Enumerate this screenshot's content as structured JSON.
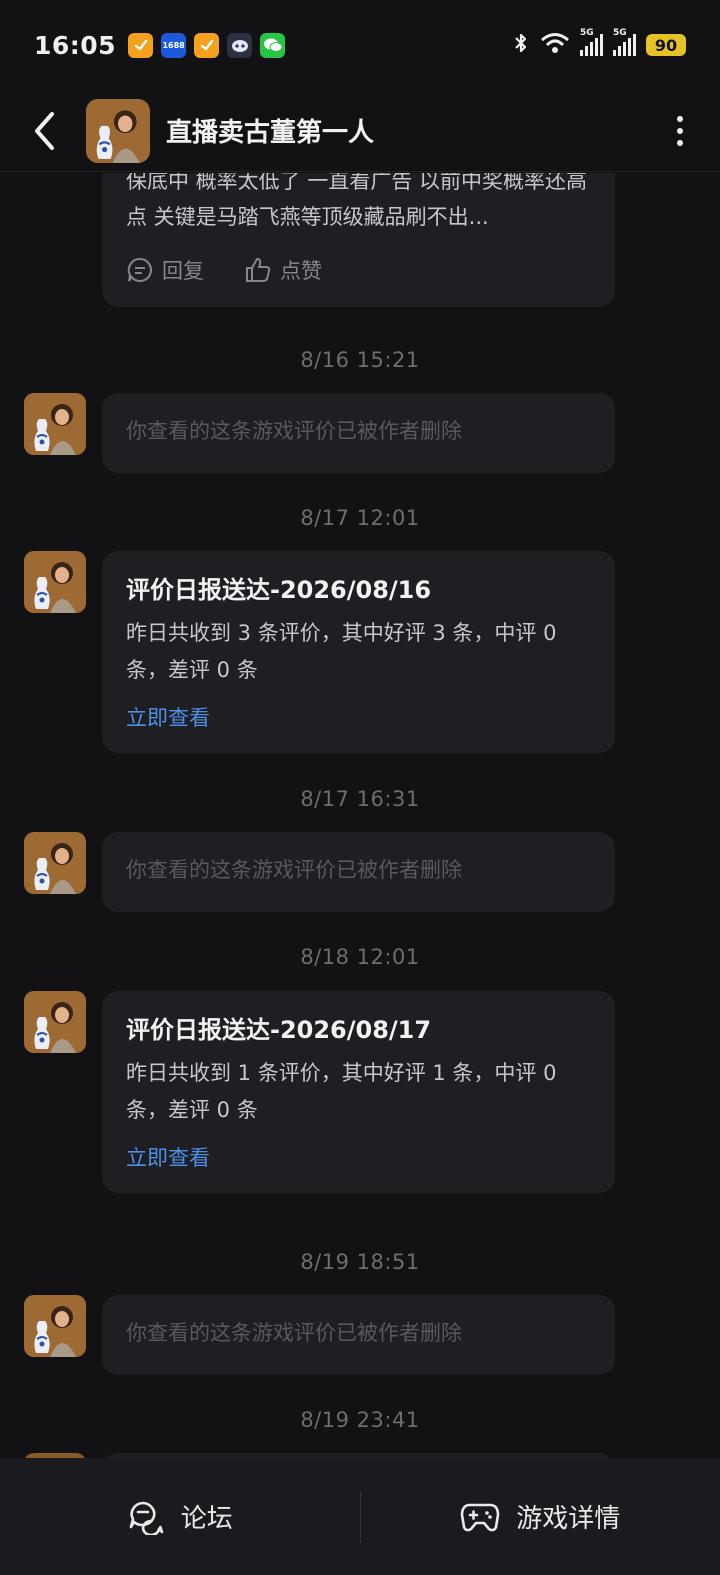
{
  "status_bar": {
    "time": "16:05",
    "app_icons": [
      "taobao-icon",
      "1688-icon",
      "taobao-icon",
      "robot-icon",
      "wechat-icon"
    ],
    "app_1688_label": "1688",
    "signal_1": "5G",
    "signal_2": "5G",
    "battery": "90"
  },
  "header": {
    "title": "直播卖古董第一人"
  },
  "chat": {
    "truncated_message": {
      "text": "保底中 概率太低了 一直看广告 以前中奖概率还高点 关键是马踏飞燕等顶级藏品刷不出...",
      "reply_label": "回复",
      "like_label": "点赞"
    },
    "messages": [
      {
        "timestamp": "8/16  15:21",
        "type": "deleted",
        "text": "你查看的这条游戏评价已被作者删除"
      },
      {
        "timestamp": "8/17  12:01",
        "type": "report",
        "title": "评价日报送达-2026/08/16",
        "body": "昨日共收到 3 条评价，其中好评 3 条，中评 0 条，差评 0 条",
        "link": "立即查看"
      },
      {
        "timestamp": "8/17  16:31",
        "type": "deleted",
        "text": "你查看的这条游戏评价已被作者删除"
      },
      {
        "timestamp": "8/18  12:01",
        "type": "report",
        "title": "评价日报送达-2026/08/17",
        "body": "昨日共收到 1 条评价，其中好评 1 条，中评 0 条，差评 0 条",
        "link": "立即查看"
      },
      {
        "timestamp": "8/19  18:51",
        "type": "deleted",
        "text": "你查看的这条游戏评价已被作者删除"
      },
      {
        "timestamp": "8/19  23:41"
      }
    ]
  },
  "bottom_bar": {
    "forum_label": "论坛",
    "game_detail_label": "游戏详情"
  },
  "colors": {
    "background": "#121214",
    "bubble": "#1e1e23",
    "link": "#4f8fe6",
    "battery": "#e6c229"
  }
}
